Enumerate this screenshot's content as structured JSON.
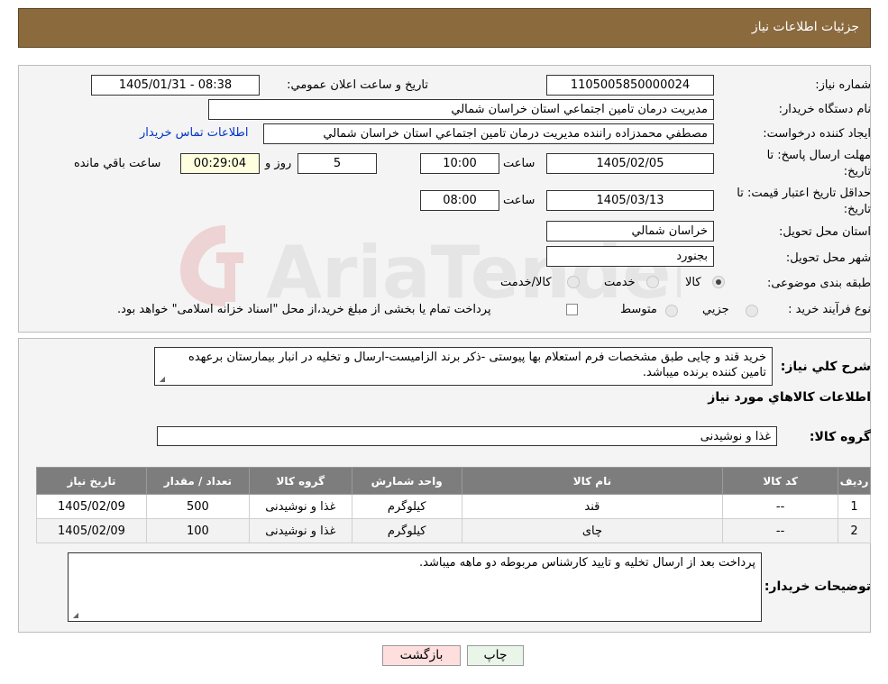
{
  "header": {
    "title": "جزئيات اطلاعات نياز"
  },
  "form": {
    "need_number_label": "شماره نياز:",
    "need_number": "1105005850000024",
    "announce_label": "تاريخ و ساعت اعلان عمومي:",
    "announce_value": "1405/01/31 - 08:38",
    "buyer_org_label": "نام دستگاه خريدار:",
    "buyer_org": "مديريت درمان تامين اجتماعي استان خراسان شمالي",
    "creator_label": "ايجاد كننده درخواست:",
    "creator": "مصطفي محمدزاده راننده مديريت درمان تامين اجتماعي استان خراسان شمالي",
    "contact_link": "اطلاعات تماس خريدار",
    "deadline_label_1": "مهلت ارسال پاسخ: تا",
    "deadline_label_2": "تاريخ:",
    "deadline_date": "1405/02/05",
    "time_label": "ساعت",
    "deadline_time": "10:00",
    "days_value": "5",
    "days_label": "روز و",
    "remaining_time": "00:29:04",
    "remaining_label": "ساعت باقي مانده",
    "validity_label_1": "حداقل تاريخ اعتبار قيمت: تا",
    "validity_label_2": "تاريخ:",
    "validity_date": "1405/03/13",
    "validity_time_label": "ساعت",
    "validity_time": "08:00",
    "province_label": "استان محل تحويل:",
    "province": "خراسان شمالي",
    "city_label": "شهر محل تحويل:",
    "city": "بجنورد",
    "category_label": "طبقه بندی موضوعی:",
    "category_options": [
      "كالا",
      "خدمت",
      "كالا/خدمت"
    ],
    "category_selected": "كالا",
    "process_label": "نوع فرآيند خريد :",
    "process_options": [
      "جزيي",
      "متوسط"
    ],
    "process_note": "پرداخت تمام يا بخشی از مبلغ خريد،از محل \"اسناد خزانه اسلامی\" خواهد بود."
  },
  "description": {
    "label": "شرح كلي نياز:",
    "text": "خريد قند و چايی طبق مشخصات فرم استعلام بها پيوستی -ذكر برند الزاميست-ارسال و تخليه در انبار بيمارستان برعهده تامين كننده برنده ميباشد.",
    "items_title": "اطلاعات كالاهاي مورد نياز",
    "group_label": "گروه كالا:",
    "group_value": "غذا و نوشيدنی"
  },
  "table": {
    "headers": [
      "رديف",
      "كد كالا",
      "نام كالا",
      "واحد شمارش",
      "گروه كالا",
      "تعداد / مقدار",
      "تاريخ نياز"
    ],
    "rows": [
      [
        "1",
        "--",
        "قند",
        "كيلوگرم",
        "غذا و نوشيدنی",
        "500",
        "1405/02/09"
      ],
      [
        "2",
        "--",
        "چای",
        "كيلوگرم",
        "غذا و نوشيدنی",
        "100",
        "1405/02/09"
      ]
    ]
  },
  "buyer_notes": {
    "label": "توضيحات خريدار:",
    "text": "پرداخت بعد از ارسال تخليه و تاييد كارشناس مربوطه دو ماهه ميباشد."
  },
  "buttons": {
    "print": "چاپ",
    "back": "بازگشت"
  },
  "colors": {
    "header_bg": "#8b6a3e",
    "link": "#0033cc",
    "table_header": "#7d7d7d",
    "back_btn": "#ffdede"
  },
  "watermark": {
    "text": "AriaTender.neT"
  }
}
